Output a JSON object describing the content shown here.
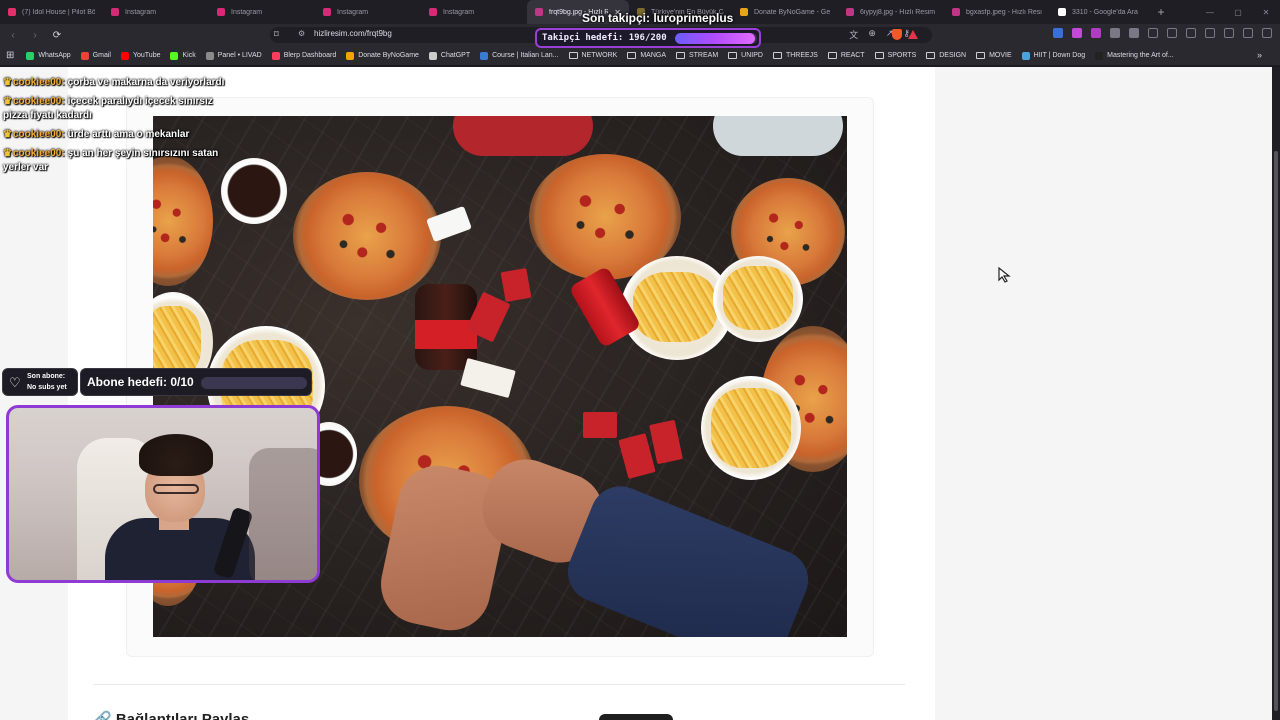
{
  "browser": {
    "tabs": [
      {
        "label": "(7) Idol House | Pilot Bölü",
        "color": "#e1306c",
        "active": false
      },
      {
        "label": "Instagram",
        "color": "#d62976",
        "active": false
      },
      {
        "label": "Instagram",
        "color": "#d62976",
        "active": false
      },
      {
        "label": "Instagram",
        "color": "#d62976",
        "active": false
      },
      {
        "label": "Instagram",
        "color": "#d62976",
        "active": false
      },
      {
        "label": "frqt9bg.jpg - Hızlı R",
        "color": "#c13584",
        "active": true
      },
      {
        "label": "Türkiye'nin En Büyük Ca",
        "color": "#7d6a2f",
        "active": false
      },
      {
        "label": "Donate ByNoGame - Ge",
        "color": "#e8a317",
        "active": false
      },
      {
        "label": "6iypyj8.jpg - Hızlı Resim",
        "color": "#c13584",
        "active": false
      },
      {
        "label": "bgxasfp.jpeg - Hızlı Resi",
        "color": "#c13584",
        "active": false
      },
      {
        "label": "3310 - Google'da Ara",
        "color": "#ffffff",
        "active": false
      }
    ],
    "new_tab": "+",
    "window_controls": [
      "—",
      "▢",
      "✕"
    ],
    "url": "hizliresim.com/frqt9bg",
    "bookmarks": [
      {
        "label": "WhatsApp",
        "type": "site",
        "color": "#25d366"
      },
      {
        "label": "Gmail",
        "type": "site",
        "color": "#ea4335"
      },
      {
        "label": "YouTube",
        "type": "site",
        "color": "#ff0000"
      },
      {
        "label": "Kick",
        "type": "site",
        "color": "#53fc18"
      },
      {
        "label": "Panel • LIVAD",
        "type": "site",
        "color": "#8a8a8a"
      },
      {
        "label": "Blerp Dashboard",
        "type": "site",
        "color": "#ff3b5c"
      },
      {
        "label": "Donate ByNoGame",
        "type": "site",
        "color": "#f0a500"
      },
      {
        "label": "ChatGPT",
        "type": "site",
        "color": "#cccccc"
      },
      {
        "label": "Course | Italian Lan...",
        "type": "site",
        "color": "#3a7bd5"
      },
      {
        "label": "NETWORK",
        "type": "folder"
      },
      {
        "label": "MANGA",
        "type": "folder"
      },
      {
        "label": "STREAM",
        "type": "folder"
      },
      {
        "label": "UNIPD",
        "type": "folder"
      },
      {
        "label": "THREEJS",
        "type": "folder"
      },
      {
        "label": "REACT",
        "type": "folder"
      },
      {
        "label": "SPORTS",
        "type": "folder"
      },
      {
        "label": "DESIGN",
        "type": "folder"
      },
      {
        "label": "MOVIE",
        "type": "folder"
      },
      {
        "label": "HIIT | Down Dog",
        "type": "site",
        "color": "#4aa3df"
      },
      {
        "label": "Mastering the Art of...",
        "type": "site",
        "color": "#222222"
      }
    ],
    "more_bookmarks": "»"
  },
  "page": {
    "section_title": "🔗 Bağlantıları Paylaş"
  },
  "overlay": {
    "last_follower": "Son takipçi: luroprimeplus",
    "follow_goal": {
      "label": "Takipçi hedefi: 196/200",
      "current": 196,
      "target": 200
    },
    "chat": [
      {
        "user": "cookiee00:",
        "text": "çorba ve makarna da veriyorlardı"
      },
      {
        "user": "cookiee00:",
        "text": "içecek paralıydı içecek sınırsız pizza fiyatı kadardı"
      },
      {
        "user": "cookiee00:",
        "text": "ürde arttı ama o mekanlar"
      },
      {
        "user": "cookiee00:",
        "text": "şu an her şeyin sınırsızını satan yerler var"
      }
    ],
    "sub": {
      "line1": "Son abone:",
      "line2": "No subs yet"
    },
    "sub_goal": {
      "label": "Abone hedefi: 0/10",
      "current": 0,
      "target": 10
    },
    "accent": "#8e3bd3"
  }
}
